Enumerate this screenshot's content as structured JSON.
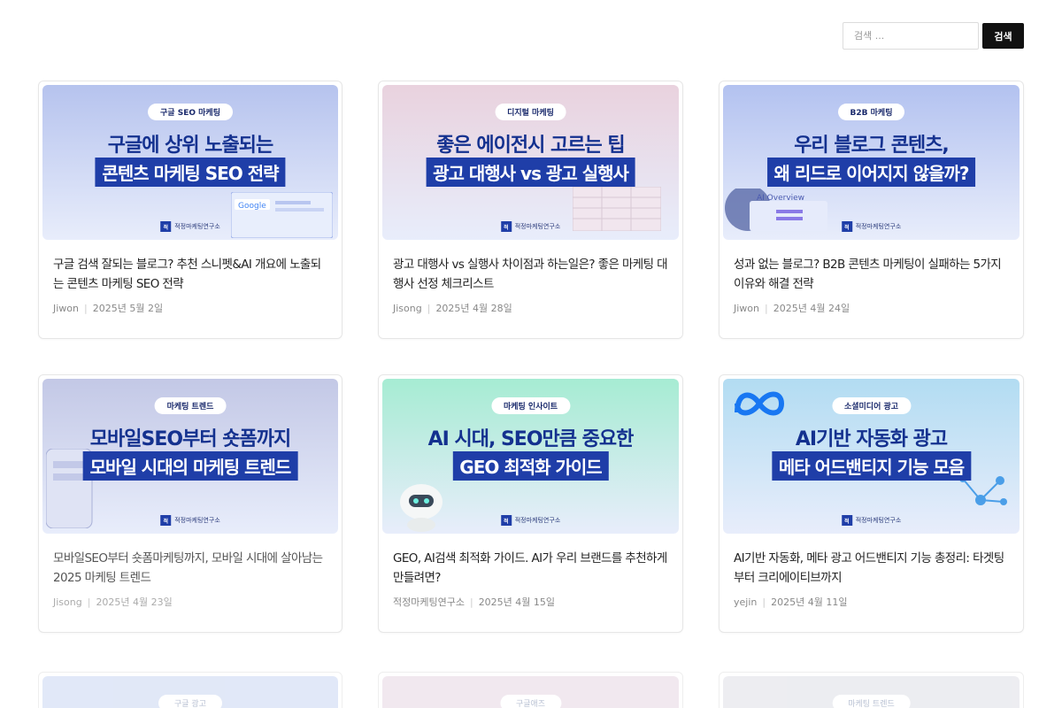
{
  "search": {
    "placeholder": "검색 ...",
    "button_label": "검색"
  },
  "posts": [
    {
      "tag": "구글 SEO 마케팅",
      "headline1": "구글에 상위 노출되는",
      "headline2": "콘텐츠 마케팅 SEO 전략",
      "logo_text": "적정마케팅연구소",
      "title": "구글 검색 잘되는 블로그? 추천 스니펫&AI 개요에 노출되는 콘텐츠 마케팅 SEO 전략",
      "author": "Jiwon",
      "date": "2025년 5월 2일",
      "bg": "#b6c3ee",
      "decoration": "google-window"
    },
    {
      "tag": "디지털 마케팅",
      "headline1": "좋은 에이전시 고르는 팁",
      "headline2": "광고 대행사 vs 광고 실행사",
      "logo_text": "적정마케팅연구소",
      "title": "광고 대행사 vs 실행사 차이점과 하는일은? 좋은 마케팅 대행사 선정 체크리스트",
      "author": "Jisong",
      "date": "2025년 4월 28일",
      "bg": "#e9d2de",
      "decoration": "spreadsheet"
    },
    {
      "tag": "B2B 마케팅",
      "headline1": "우리 블로그 콘텐츠,",
      "headline2": "왜 리드로 이어지지 않을까?",
      "logo_text": "적정마케팅연구소",
      "title": "성과 없는 블로그? B2B 콘텐츠 마케팅이 실패하는 5가지 이유와 해결 전략",
      "author": "Jiwon",
      "date": "2025년 4월 24일",
      "bg": "#b3c2f0",
      "decoration": "ai-overview",
      "decoration_text": "AI Overview"
    },
    {
      "tag": "마케팅 트렌드",
      "headline1": "모바일SEO부터 숏폼까지",
      "headline2": "모바일 시대의 마케팅 트렌드",
      "logo_text": "적정마케팅연구소",
      "title": "모바일SEO부터 숏폼마케팅까지, 모바일 시대에 살아남는 2025 마케팅 트렌드",
      "author": "Jisong",
      "date": "2025년 4월 23일",
      "bg": "#c3c8e6",
      "decoration": "phone",
      "dim": true
    },
    {
      "tag": "마케팅 인사이트",
      "headline1": "AI 시대, SEO만큼 중요한",
      "headline2": "GEO 최적화 가이드",
      "logo_text": "적정마케팅연구소",
      "title": "GEO, AI검색 최적화 가이드. AI가 우리 브랜드를 추천하게 만들려면?",
      "author": "적정마케팅연구소",
      "date": "2025년 4월 15일",
      "bg": "#a6ecd3",
      "decoration": "robot"
    },
    {
      "tag": "소셜미디어 광고",
      "headline1": "AI기반 자동화 광고",
      "headline2": "메타 어드밴티지 기능 모음",
      "logo_text": "적정마케팅연구소",
      "title": "AI기반 자동화, 메타 광고 어드밴티지 기능 총정리: 타겟팅부터 크리에이티브까지",
      "author": "yejin",
      "date": "2025년 4월 11일",
      "bg": "#b2dcf2",
      "decoration": "meta"
    }
  ],
  "partial_posts": [
    {
      "tag": "구글 광고",
      "bg": "#c9d6f2"
    },
    {
      "tag": "구글애즈",
      "bg": "#e6d6e2"
    },
    {
      "tag": "마케팅 트렌드",
      "bg": "#dedfe6"
    }
  ],
  "colors": {
    "accent_dark": "#14318f",
    "band": "#1f3ea8",
    "search_button": "#111111"
  }
}
